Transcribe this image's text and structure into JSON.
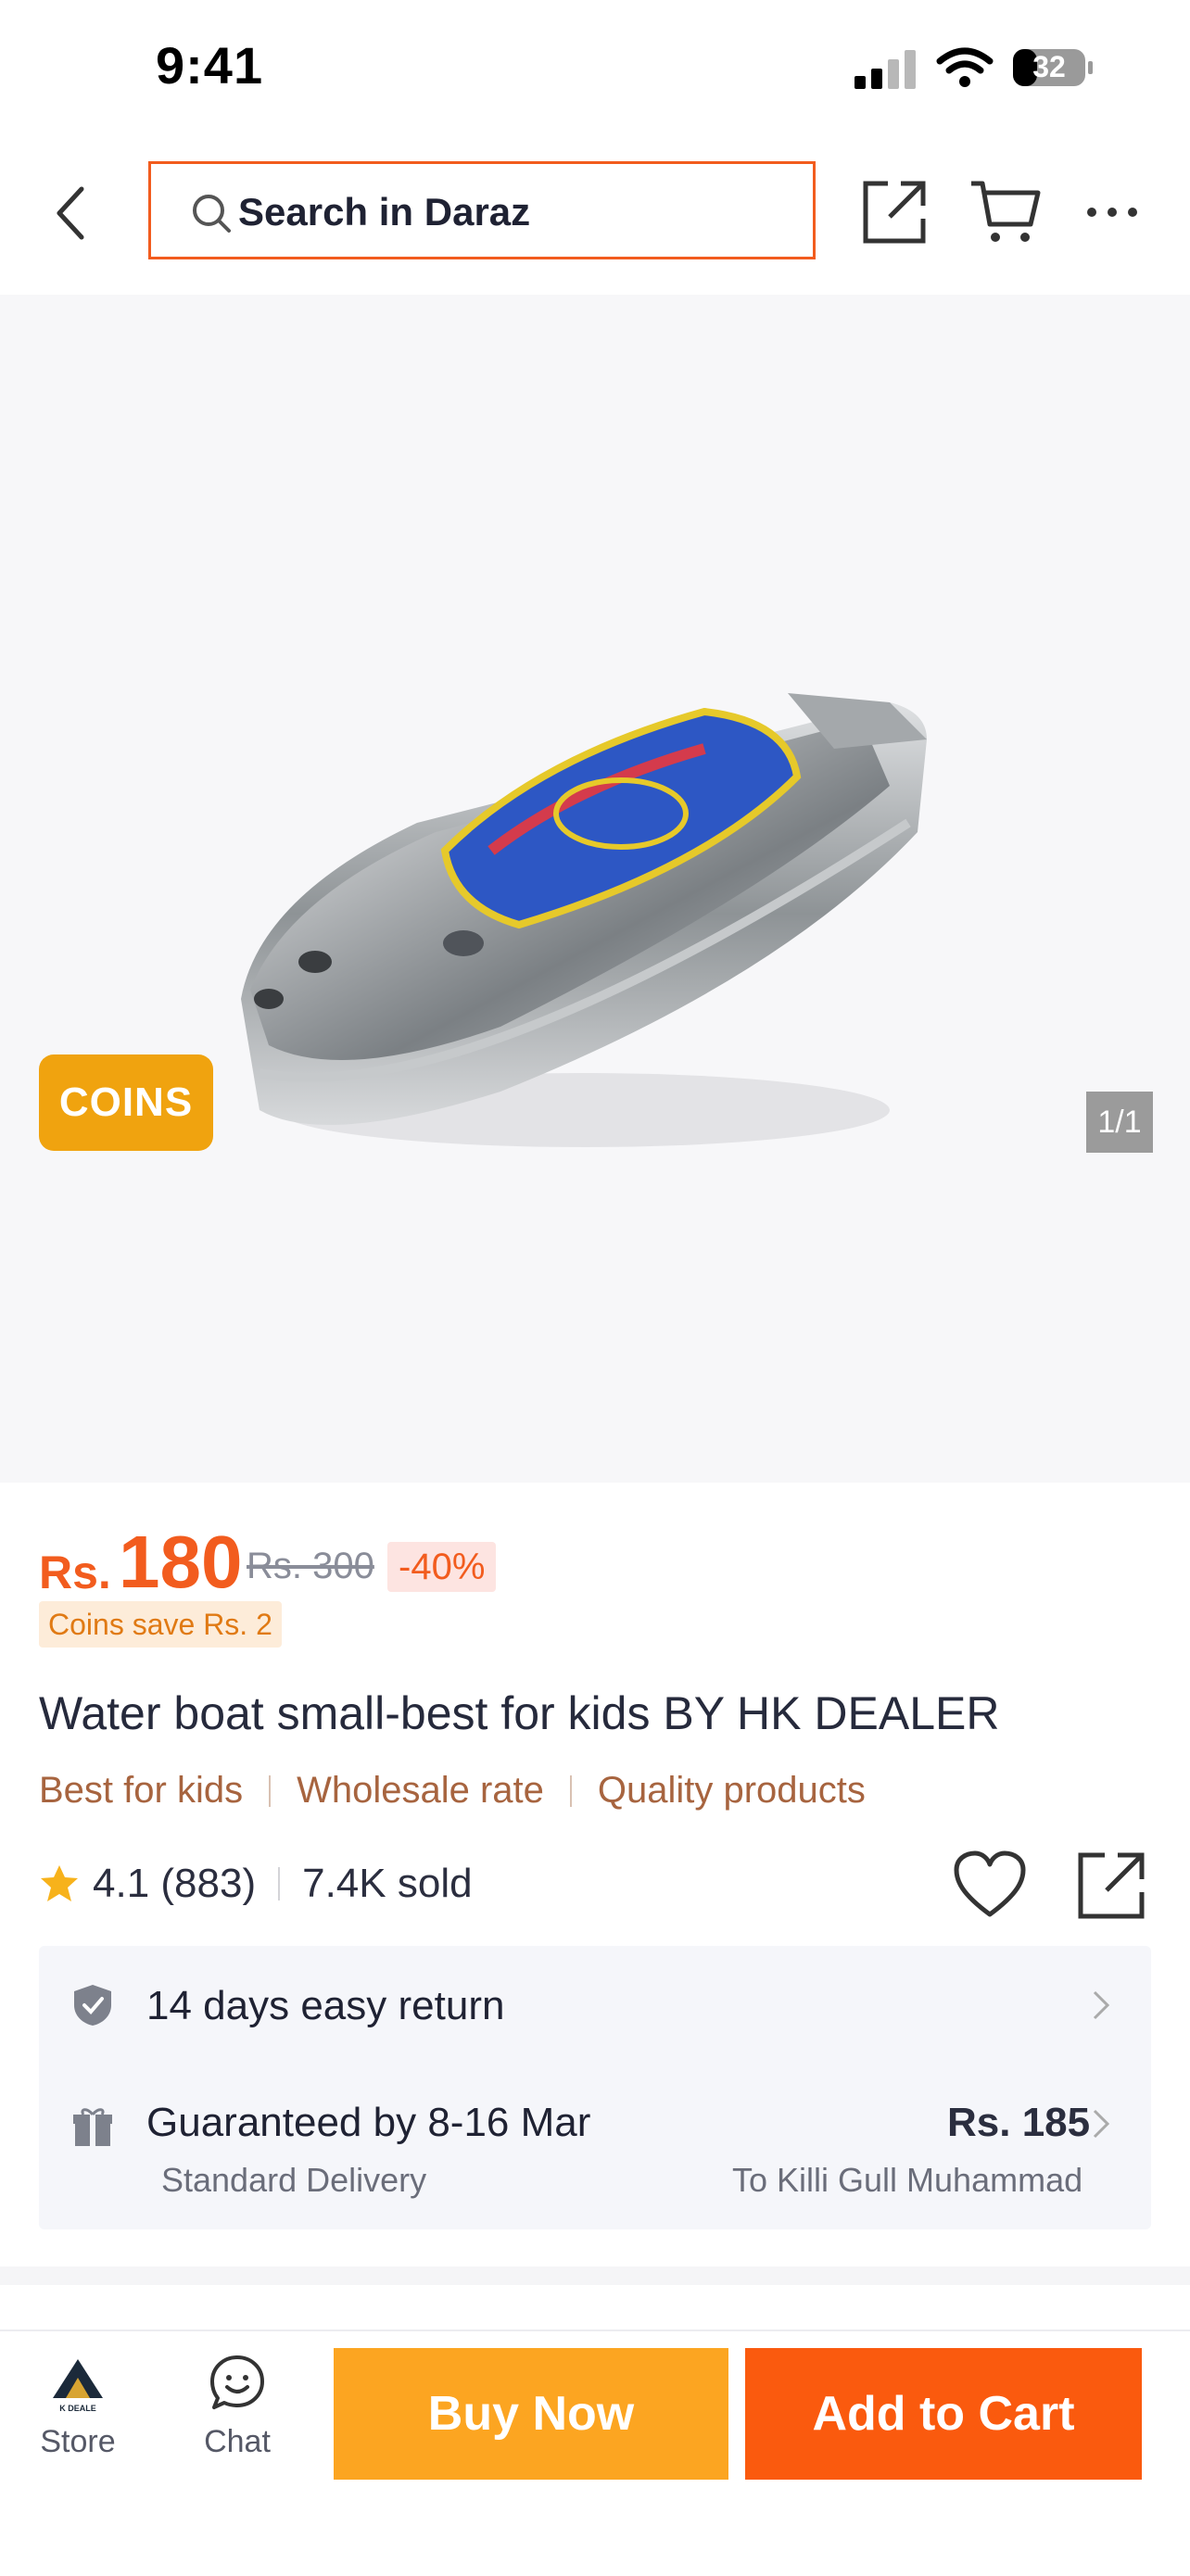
{
  "status_bar": {
    "time": "9:41",
    "battery": "32"
  },
  "header": {
    "search_placeholder": "Search in Daraz"
  },
  "gallery": {
    "coins_badge": "COINS",
    "counter": "1/1"
  },
  "price": {
    "currency": "Rs.",
    "current": "180",
    "original": "Rs. 300",
    "discount": "-40%",
    "coins_save": "Coins save Rs. 2"
  },
  "product": {
    "title": "Water boat small-best for kids BY HK DEALER",
    "tags": [
      "Best for kids",
      "Wholesale rate",
      "Quality products"
    ],
    "rating": "4.1 (883)",
    "sold": "7.4K sold"
  },
  "info": {
    "return": "14 days easy return",
    "delivery_title": "Guaranteed by 8-16 Mar",
    "delivery_sub": "Standard Delivery",
    "fee": "Rs. 185",
    "destination": "To Killi Gull Muhammad"
  },
  "bottom": {
    "store": "Store",
    "store_logo_text": "K DEALE",
    "chat": "Chat",
    "buy_now": "Buy Now",
    "add_to_cart": "Add to Cart"
  },
  "colors": {
    "accent": "#f25c1e",
    "buy_now": "#fca521",
    "add_to_cart": "#fa5a0e",
    "coins": "#f0a30f",
    "tag_text": "#a7643f"
  }
}
